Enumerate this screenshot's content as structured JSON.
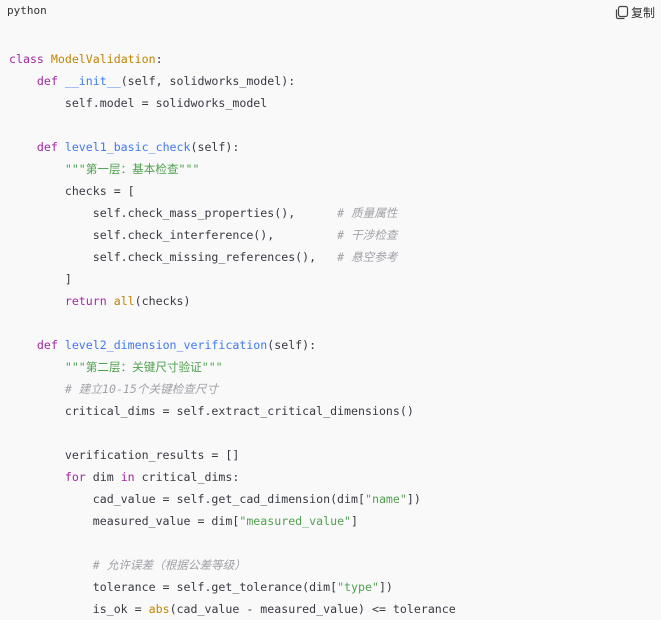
{
  "header": {
    "language": "python",
    "copy_label": "复制"
  },
  "code": {
    "lines": [
      [
        {
          "t": "class ",
          "c": "kw"
        },
        {
          "t": "ModelValidation",
          "c": "cls"
        },
        {
          "t": ":",
          "c": "plain"
        }
      ],
      [
        {
          "t": "    ",
          "c": "plain"
        },
        {
          "t": "def ",
          "c": "kw"
        },
        {
          "t": "__init__",
          "c": "fn"
        },
        {
          "t": "(self, solidworks_model):",
          "c": "plain"
        }
      ],
      [
        {
          "t": "        self.model = solidworks_model",
          "c": "plain"
        }
      ],
      [],
      [
        {
          "t": "    ",
          "c": "plain"
        },
        {
          "t": "def ",
          "c": "kw"
        },
        {
          "t": "level1_basic_check",
          "c": "fn"
        },
        {
          "t": "(self):",
          "c": "plain"
        }
      ],
      [
        {
          "t": "        ",
          "c": "plain"
        },
        {
          "t": "\"\"\"第一层：基本检查\"\"\"",
          "c": "str"
        }
      ],
      [
        {
          "t": "        checks = [",
          "c": "plain"
        }
      ],
      [
        {
          "t": "            self.check_mass_properties(),      ",
          "c": "plain"
        },
        {
          "t": "# 质量属性",
          "c": "cm"
        }
      ],
      [
        {
          "t": "            self.check_interference(),         ",
          "c": "plain"
        },
        {
          "t": "# 干涉检查",
          "c": "cm"
        }
      ],
      [
        {
          "t": "            self.check_missing_references(),   ",
          "c": "plain"
        },
        {
          "t": "# 悬空参考",
          "c": "cm"
        }
      ],
      [
        {
          "t": "        ]",
          "c": "plain"
        }
      ],
      [
        {
          "t": "        ",
          "c": "plain"
        },
        {
          "t": "return ",
          "c": "kw"
        },
        {
          "t": "all",
          "c": "cls"
        },
        {
          "t": "(checks)",
          "c": "plain"
        }
      ],
      [],
      [
        {
          "t": "    ",
          "c": "plain"
        },
        {
          "t": "def ",
          "c": "kw"
        },
        {
          "t": "level2_dimension_verification",
          "c": "fn"
        },
        {
          "t": "(self):",
          "c": "plain"
        }
      ],
      [
        {
          "t": "        ",
          "c": "plain"
        },
        {
          "t": "\"\"\"第二层：关键尺寸验证\"\"\"",
          "c": "str"
        }
      ],
      [
        {
          "t": "        ",
          "c": "plain"
        },
        {
          "t": "# 建立10-15个关键检查尺寸",
          "c": "cm"
        }
      ],
      [
        {
          "t": "        critical_dims = self.extract_critical_dimensions()",
          "c": "plain"
        }
      ],
      [],
      [
        {
          "t": "        verification_results = []",
          "c": "plain"
        }
      ],
      [
        {
          "t": "        ",
          "c": "plain"
        },
        {
          "t": "for ",
          "c": "kw"
        },
        {
          "t": "dim ",
          "c": "plain"
        },
        {
          "t": "in ",
          "c": "kw"
        },
        {
          "t": "critical_dims:",
          "c": "plain"
        }
      ],
      [
        {
          "t": "            cad_value = self.get_cad_dimension(dim[",
          "c": "plain"
        },
        {
          "t": "\"name\"",
          "c": "str"
        },
        {
          "t": "])",
          "c": "plain"
        }
      ],
      [
        {
          "t": "            measured_value = dim[",
          "c": "plain"
        },
        {
          "t": "\"measured_value\"",
          "c": "str"
        },
        {
          "t": "]",
          "c": "plain"
        }
      ],
      [],
      [
        {
          "t": "            ",
          "c": "plain"
        },
        {
          "t": "# 允许误差（根据公差等级）",
          "c": "cm"
        }
      ],
      [
        {
          "t": "            tolerance = self.get_tolerance(dim[",
          "c": "plain"
        },
        {
          "t": "\"type\"",
          "c": "str"
        },
        {
          "t": "])",
          "c": "plain"
        }
      ],
      [
        {
          "t": "            is_ok = ",
          "c": "plain"
        },
        {
          "t": "abs",
          "c": "cls"
        },
        {
          "t": "(cad_value - measured_value) <= tolerance",
          "c": "plain"
        }
      ]
    ]
  }
}
